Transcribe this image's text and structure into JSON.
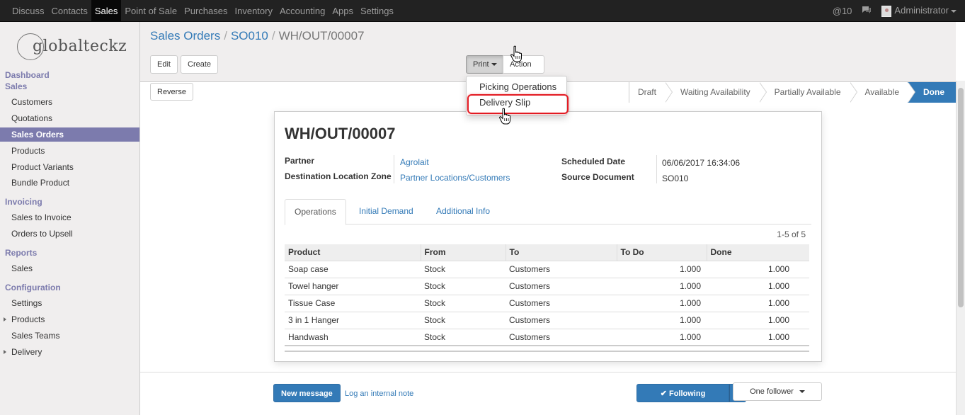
{
  "navbar": {
    "menu": [
      {
        "label": "Discuss",
        "active": false
      },
      {
        "label": "Contacts",
        "active": false
      },
      {
        "label": "Sales",
        "active": true
      },
      {
        "label": "Point of Sale",
        "active": false
      },
      {
        "label": "Purchases",
        "active": false
      },
      {
        "label": "Inventory",
        "active": false
      },
      {
        "label": "Accounting",
        "active": false
      },
      {
        "label": "Apps",
        "active": false
      },
      {
        "label": "Settings",
        "active": false
      }
    ],
    "mentions": "@10",
    "user": "Administrator"
  },
  "sidebar": {
    "logo_text": "globalteckz",
    "sections": [
      {
        "heading": "Dashboard"
      },
      {
        "heading": "Sales",
        "items": [
          "Customers",
          "Quotations",
          "Sales Orders",
          "Products",
          "Product Variants",
          "Bundle Product"
        ]
      },
      {
        "heading": "Invoicing",
        "items": [
          "Sales to Invoice",
          "Orders to Upsell"
        ]
      },
      {
        "heading": "Reports",
        "items": [
          "Sales"
        ]
      },
      {
        "heading": "Configuration",
        "items": [
          "Settings",
          "Products",
          "Sales Teams",
          "Delivery"
        ]
      }
    ],
    "active_item": "Sales Orders"
  },
  "breadcrumb": {
    "items": [
      "Sales Orders",
      "SO010"
    ],
    "current": "WH/OUT/00007",
    "separator": "/"
  },
  "toolbar": {
    "edit_label": "Edit",
    "create_label": "Create",
    "print_label": "Print",
    "action_label": "Action",
    "reverse_label": "Reverse"
  },
  "print_menu": {
    "items": [
      "Picking Operations",
      "Delivery Slip"
    ],
    "highlighted": "Delivery Slip"
  },
  "statusbar": {
    "stages": [
      "Draft",
      "Waiting Availability",
      "Partially Available",
      "Available",
      "Done"
    ],
    "current": "Done"
  },
  "form": {
    "title": "WH/OUT/00007",
    "partner_label": "Partner",
    "partner_value": "Agrolait",
    "dest_label": "Destination Location Zone",
    "dest_value": "Partner Locations/Customers",
    "sched_label": "Scheduled Date",
    "sched_value": "06/06/2017 16:34:06",
    "source_label": "Source Document",
    "source_value": "SO010",
    "tabs": [
      "Operations",
      "Initial Demand",
      "Additional Info"
    ],
    "active_tab": "Operations",
    "pager": "1-5 of 5",
    "table": {
      "headers": [
        "Product",
        "From",
        "To",
        "To Do",
        "Done"
      ],
      "rows": [
        [
          "Soap case",
          "Stock",
          "Customers",
          "1.000",
          "1.000"
        ],
        [
          "Towel hanger",
          "Stock",
          "Customers",
          "1.000",
          "1.000"
        ],
        [
          "Tissue Case",
          "Stock",
          "Customers",
          "1.000",
          "1.000"
        ],
        [
          "3 in 1 Hanger",
          "Stock",
          "Customers",
          "1.000",
          "1.000"
        ],
        [
          "Handwash",
          "Stock",
          "Customers",
          "1.000",
          "1.000"
        ]
      ]
    }
  },
  "chatter": {
    "new_message": "New message",
    "log_note": "Log an internal note",
    "following": "Following",
    "followers": "One follower"
  },
  "colors": {
    "brand": "#7c7bad",
    "primary": "#337ab7",
    "highlight": "#e31b23"
  }
}
